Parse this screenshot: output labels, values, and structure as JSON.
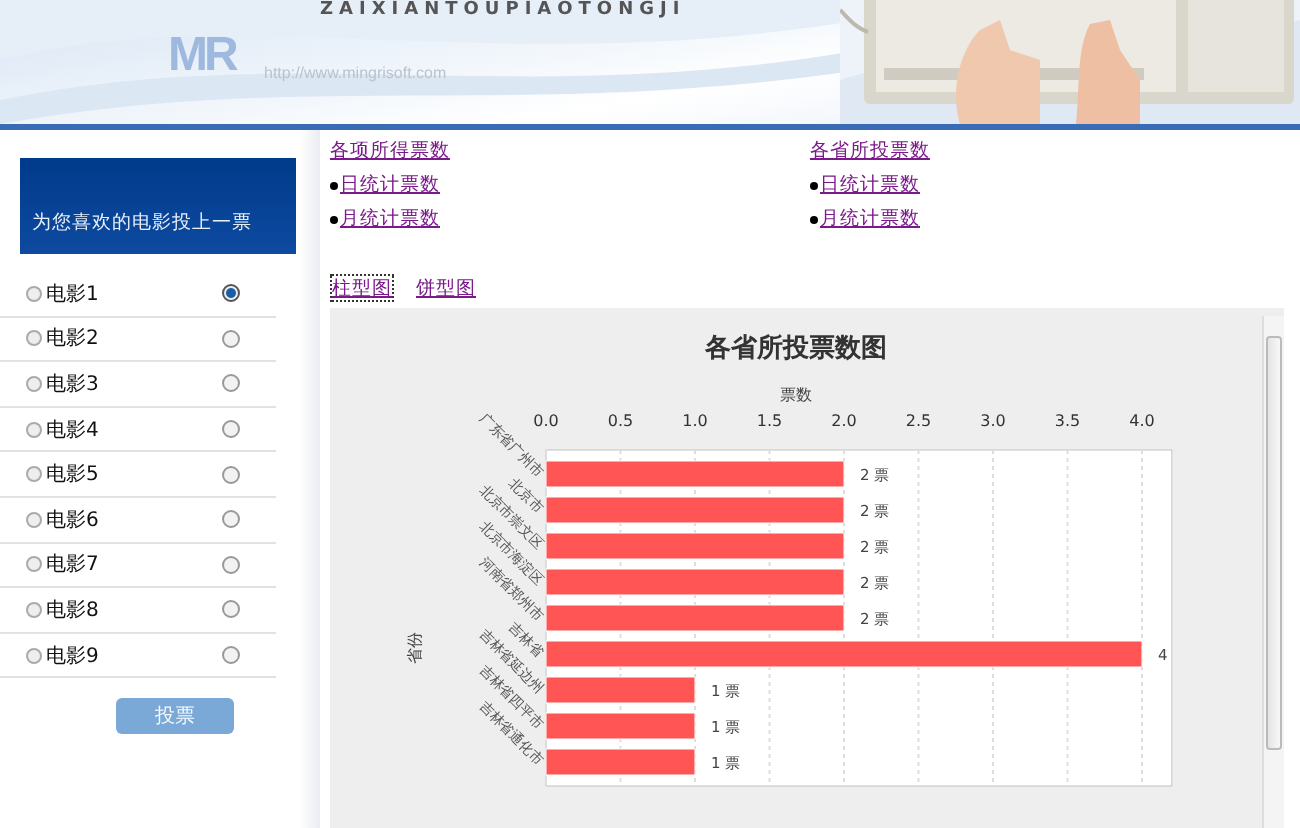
{
  "banner": {
    "subtitle": "ZAIXIANTOUPIAOTONGJI",
    "logo": "MR",
    "url": "http://www.mingrisoft.com"
  },
  "sidebar": {
    "title": "为您喜欢的电影投上一票",
    "movies": [
      {
        "label": "电影1",
        "selected": true
      },
      {
        "label": "电影2",
        "selected": false
      },
      {
        "label": "电影3",
        "selected": false
      },
      {
        "label": "电影4",
        "selected": false
      },
      {
        "label": "电影5",
        "selected": false
      },
      {
        "label": "电影6",
        "selected": false
      },
      {
        "label": "电影7",
        "selected": false
      },
      {
        "label": "电影8",
        "selected": false
      },
      {
        "label": "电影9",
        "selected": false
      }
    ],
    "vote_button": "投票"
  },
  "links": {
    "columns": [
      {
        "heading": "各项所得票数",
        "items": [
          "日统计票数",
          "月统计票数"
        ]
      },
      {
        "heading": "各省所投票数",
        "items": [
          "日统计票数",
          "月统计票数"
        ]
      }
    ]
  },
  "chart_tabs": [
    {
      "label": "柱型图",
      "selected": true
    },
    {
      "label": "饼型图",
      "selected": false
    }
  ],
  "chart": {
    "chart_data": {
      "type": "bar",
      "orientation": "horizontal",
      "title": "各省所投票数图",
      "xlabel": "票数",
      "ylabel": "省份",
      "categories": [
        "广东省广州市",
        "北京市",
        "北京市崇文区",
        "北京市海淀区",
        "河南省郑州市",
        "吉林省",
        "吉林省延边州",
        "吉林省四平市",
        "吉林省通化市"
      ],
      "series": [
        {
          "color": "#ff5555",
          "values": [
            2,
            2,
            2,
            2,
            2,
            4,
            1,
            1,
            1
          ]
        }
      ],
      "grid": true,
      "xlim": [
        0,
        4.2
      ],
      "xticks": [
        {
          "value": 0,
          "label": "0.0"
        },
        {
          "value": 0.5,
          "label": "0.5"
        },
        {
          "value": 1,
          "label": "1.0"
        },
        {
          "value": 1.5,
          "label": "1.5"
        },
        {
          "value": 2,
          "label": "2.0"
        },
        {
          "value": 2.5,
          "label": "2.5"
        },
        {
          "value": 3,
          "label": "3.0"
        },
        {
          "value": 3.5,
          "label": "3.5"
        },
        {
          "value": 4,
          "label": "4.0"
        }
      ],
      "value_labels": [
        "2 票",
        "2 票",
        "2 票",
        "2 票",
        "2 票",
        "4",
        "1 票",
        "1 票",
        "1 票"
      ]
    }
  }
}
